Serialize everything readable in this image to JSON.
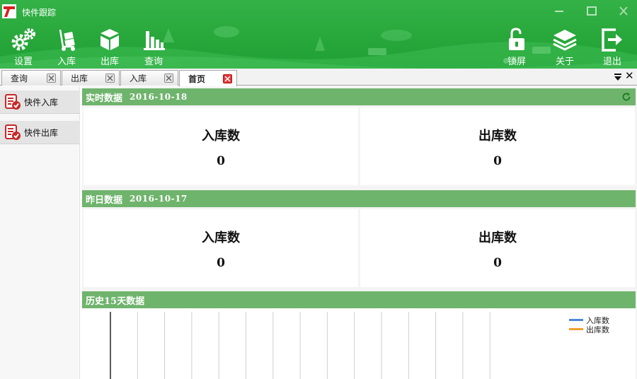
{
  "window": {
    "title": "快件跟踪"
  },
  "toolbar": {
    "settings": "设置",
    "inbound": "入库",
    "outbound": "出库",
    "query": "查询",
    "lock": "锁屏",
    "about": "关于",
    "exit": "退出"
  },
  "tabs": [
    {
      "label": "查询",
      "active": false
    },
    {
      "label": "出库",
      "active": false
    },
    {
      "label": "入库",
      "active": false
    },
    {
      "label": "首页",
      "active": true
    }
  ],
  "sidebar": {
    "items": [
      {
        "label": "快件入库"
      },
      {
        "label": "快件出库"
      }
    ]
  },
  "realtime": {
    "title": "实时数据",
    "date": "2016-10-18",
    "inbound_label": "入库数",
    "inbound_value": "0",
    "outbound_label": "出库数",
    "outbound_value": "0"
  },
  "yesterday": {
    "title": "昨日数据",
    "date": "2016-10-17",
    "inbound_label": "入库数",
    "inbound_value": "0",
    "outbound_label": "出库数",
    "outbound_value": "0"
  },
  "history": {
    "title": "历史15天数据"
  },
  "chart_data": {
    "type": "line",
    "series": [
      {
        "name": "入库数",
        "color": "#4a86d8",
        "values": []
      },
      {
        "name": "出库数",
        "color": "#f0a030",
        "values": []
      }
    ],
    "grid": true,
    "legend": "top-right"
  },
  "colors": {
    "header_green": "#28a73b",
    "panel_green": "#6fb46c",
    "close_red": "#e33838"
  },
  "icons": {
    "settings": "gears-icon",
    "inbound": "hand-truck-icon",
    "outbound": "boxes-icon",
    "query": "bar-chart-icon",
    "lock": "unlock-icon",
    "about": "layers-icon",
    "exit": "exit-icon",
    "refresh": "refresh-icon"
  }
}
